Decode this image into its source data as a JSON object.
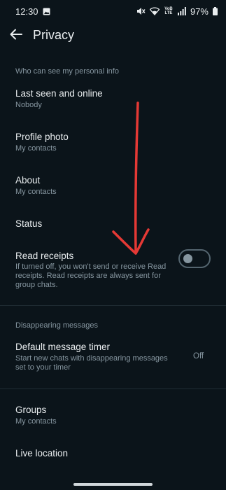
{
  "status_bar": {
    "time": "12:30",
    "network": "VoB LTE",
    "battery": "97%",
    "icons": [
      "gallery-notification-icon",
      "mute-icon",
      "wifi-icon",
      "volte-icon",
      "signal-icon",
      "battery-icon"
    ]
  },
  "app_bar": {
    "back_icon": "arrow-left-icon",
    "title": "Privacy"
  },
  "personal_info": {
    "header": "Who can see my personal info",
    "last_seen": {
      "title": "Last seen and online",
      "value": "Nobody"
    },
    "profile_photo": {
      "title": "Profile photo",
      "value": "My contacts"
    },
    "about": {
      "title": "About",
      "value": "My contacts"
    },
    "status": {
      "title": "Status"
    },
    "read_receipts": {
      "title": "Read receipts",
      "desc_line1": "If turned off, you won't send or receive Read",
      "desc_line2": "receipts. Read receipts are always sent for",
      "desc_line3": "group chats.",
      "enabled": false
    }
  },
  "disappearing": {
    "header": "Disappearing messages",
    "default_timer": {
      "title": "Default message timer",
      "desc_line1": "Start new chats with disappearing messages",
      "desc_line2": "set to your timer",
      "value": "Off"
    }
  },
  "other": {
    "groups": {
      "title": "Groups",
      "value": "My contacts"
    },
    "live_location": {
      "title": "Live location"
    }
  },
  "colors": {
    "background": "#0b141a",
    "primary_text": "#e9edef",
    "secondary_text": "#8696a0",
    "annotation_arrow": "#e53935"
  }
}
